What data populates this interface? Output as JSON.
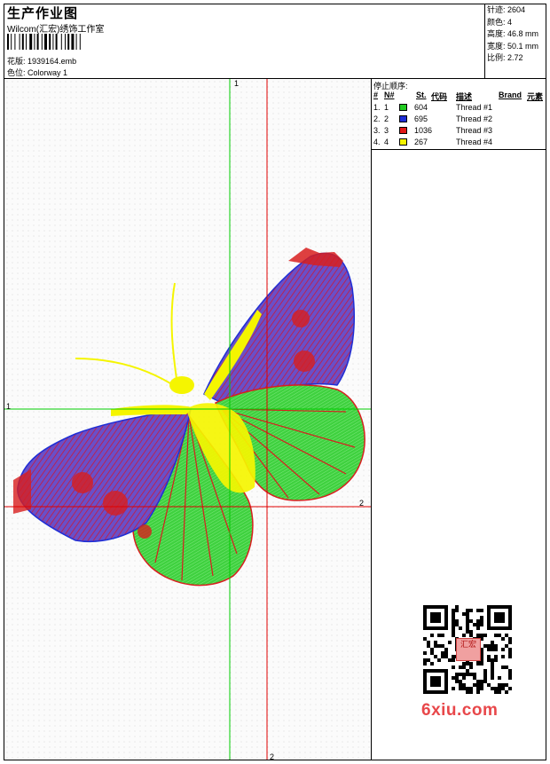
{
  "header": {
    "title": "生产作业图",
    "studio": "Wilcom(汇宏)绣饰工作室",
    "design_label": "花版:",
    "design_value": "1939164.emb",
    "colorway_label": "色位:",
    "colorway_value": "Colorway 1"
  },
  "stats": [
    {
      "label": "针迹:",
      "value": "2604"
    },
    {
      "label": "颜色:",
      "value": "4"
    },
    {
      "label": "高度:",
      "value": "46.8 mm"
    },
    {
      "label": "宽度:",
      "value": "50.1 mm"
    },
    {
      "label": "比例:",
      "value": "2.72"
    }
  ],
  "stop_sequence": {
    "title": "停止顺序:",
    "columns": [
      "#",
      "N#",
      "St.",
      "代码",
      "描述",
      "Brand",
      "元素"
    ],
    "rows": [
      {
        "num": "1.",
        "n": "1",
        "stitches": "604",
        "description": "Thread #1",
        "color": "#22cc22"
      },
      {
        "num": "2.",
        "n": "2",
        "stitches": "695",
        "description": "Thread #2",
        "color": "#1e2ed6"
      },
      {
        "num": "3.",
        "n": "3",
        "stitches": "1036",
        "description": "Thread #3",
        "color": "#e01818"
      },
      {
        "num": "4.",
        "n": "4",
        "stitches": "267",
        "description": "Thread #4",
        "color": "#f5f500"
      }
    ]
  },
  "axes": {
    "green_label": "1",
    "red_label": "2",
    "green_color": "#00cc00",
    "red_color": "#e00000"
  },
  "watermark": {
    "site": "6xiu.com",
    "seal": "汇宏"
  }
}
